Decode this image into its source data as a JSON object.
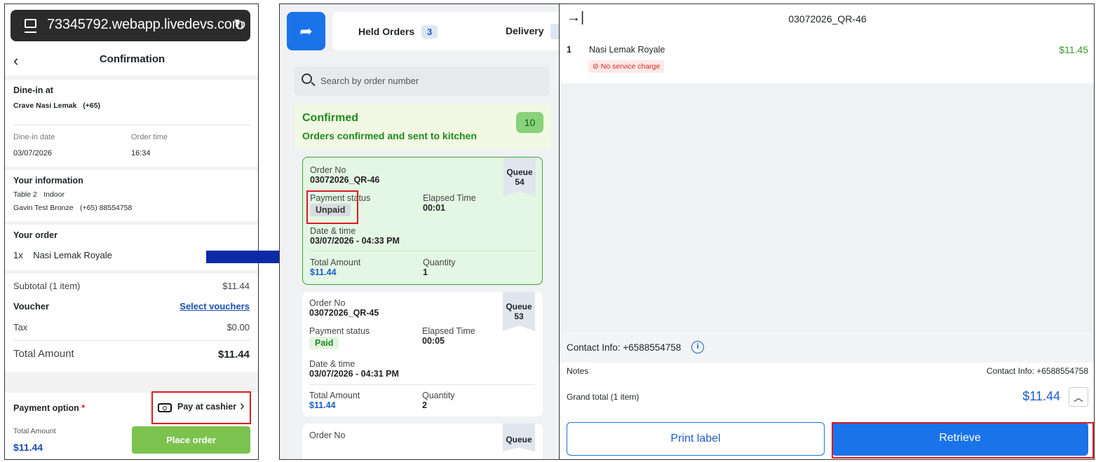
{
  "left": {
    "url": "73345792.webapp.livedevs.com",
    "title": "Confirmation",
    "dine_in_label": "Dine-in at",
    "restaurant": "Crave Nasi Lemak",
    "phone_code": "(+65)",
    "date_label": "Dine-in date",
    "date_value": "03/07/2026",
    "time_label": "Order time",
    "time_value": "16:34",
    "info_label": "Your information",
    "table": "Table 2",
    "location": "Indoor",
    "customer": "Gavin Test Bronze",
    "customer_phone": "(+65) 88554758",
    "order_label": "Your order",
    "item_qty": "1x",
    "item_name": "Nasi Lemak Royale",
    "subtotal_label": "Subtotal (1 item)",
    "subtotal_value": "$11.44",
    "voucher_label": "Voucher",
    "voucher_link": "Select vouchers",
    "tax_label": "Tax",
    "tax_value": "$0.00",
    "total_label": "Total Amount",
    "total_value": "$11.44",
    "payment_label": "Payment option",
    "payment_required": "*",
    "payment_method": "Pay at cashier",
    "footer_total_label": "Total Amount",
    "footer_total_value": "$11.44",
    "place_order": "Place order"
  },
  "mid": {
    "tab_held": "Held Orders",
    "tab_held_count": "3",
    "tab_delivery": "Delivery",
    "search_placeholder": "Search by order number",
    "section_title": "Confirmed",
    "section_sub": "Orders confirmed and sent to kitchen",
    "section_count": "10",
    "labels": {
      "order_no": "Order No",
      "queue": "Queue",
      "payment_status": "Payment status",
      "elapsed": "Elapsed Time",
      "datetime": "Date & time",
      "total": "Total Amount",
      "quantity": "Quantity"
    },
    "orders": [
      {
        "order_no": "03072026_QR-46",
        "queue": "54",
        "status": "Unpaid",
        "elapsed": "00:01",
        "datetime": "03/07/2026 - 04:33 PM",
        "total": "$11.44",
        "quantity": "1"
      },
      {
        "order_no": "03072026_QR-45",
        "queue": "53",
        "status": "Paid",
        "elapsed": "00:05",
        "datetime": "03/07/2026 - 04:31 PM",
        "total": "$11.44",
        "quantity": "2"
      }
    ]
  },
  "right": {
    "order_title": "03072026_QR-46",
    "item_index": "1",
    "item_name": "Nasi Lemak Royale",
    "item_price": "$11.45",
    "no_service_charge": "No service charge",
    "contact_info": "Contact Info: +6588554758",
    "notes_label": "Notes",
    "notes_contact": "Contact Info: +6588554758",
    "grand_total_label": "Grand total (1 item)",
    "grand_total_value": "$11.44",
    "print_label": "Print label",
    "retrieve": "Retrieve"
  },
  "colors": {
    "accent_blue": "#1a73e8",
    "confirmed_green": "#1e8a1e",
    "highlight_red": "#e0191f",
    "arrow_navy": "#0d2aa6",
    "place_order_green": "#7cc24f"
  }
}
